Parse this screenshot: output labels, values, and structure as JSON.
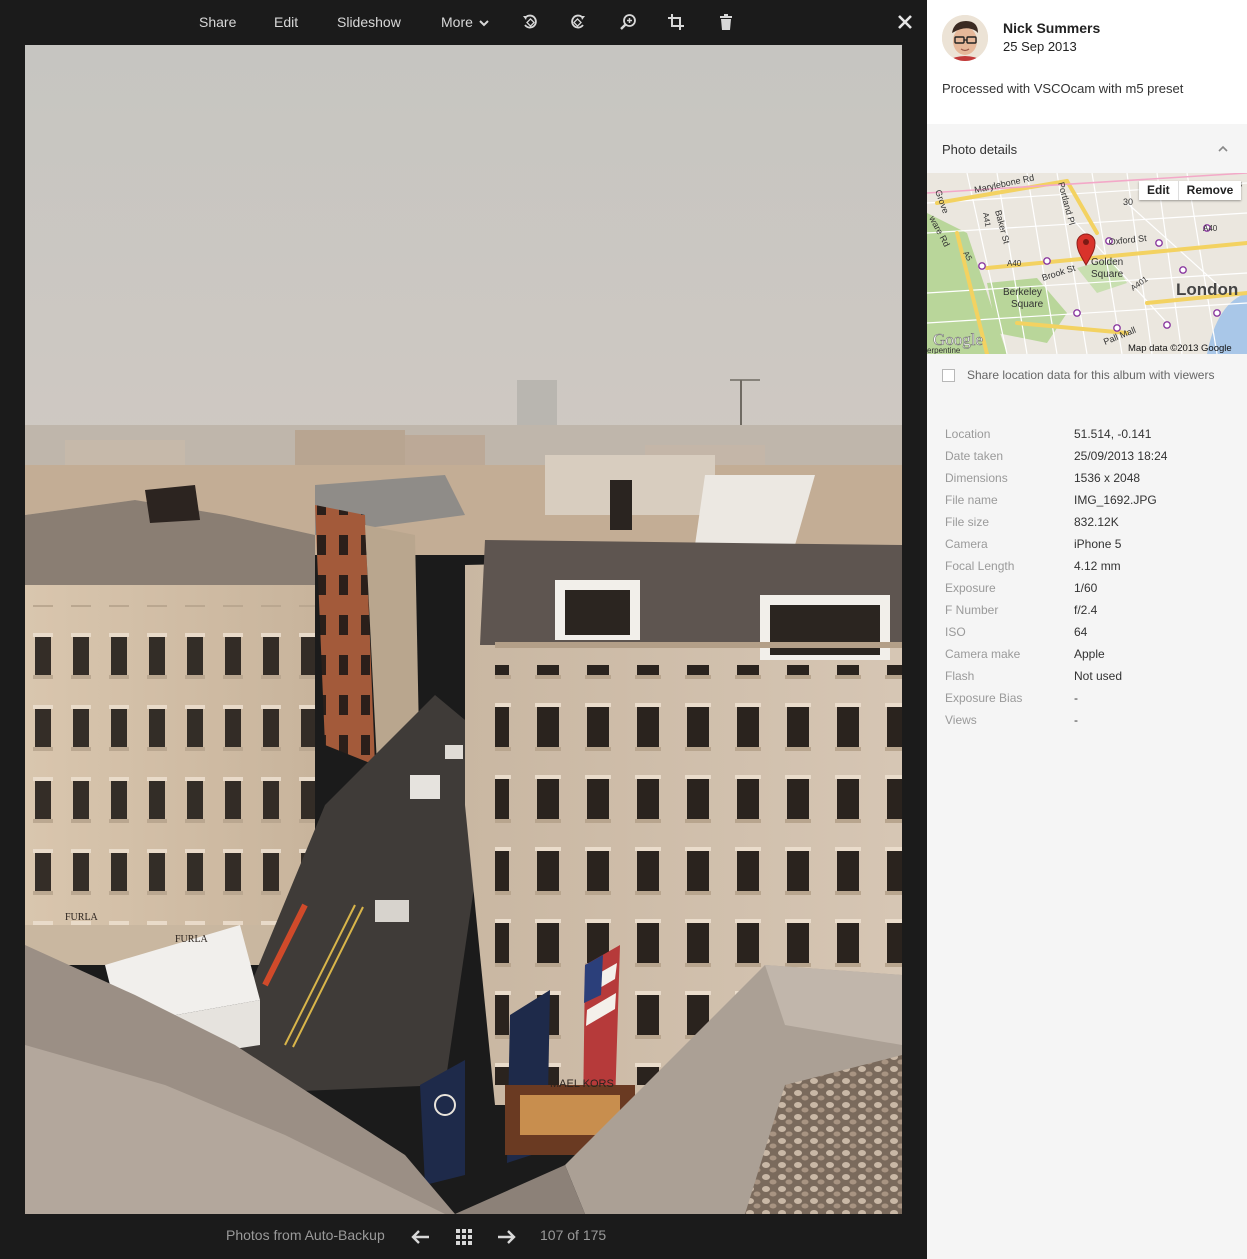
{
  "toolbar": {
    "share": "Share",
    "edit": "Edit",
    "slideshow": "Slideshow",
    "more": "More"
  },
  "bottom": {
    "album": "Photos from Auto-Backup",
    "counter": "107 of 175"
  },
  "panel": {
    "owner_name": "Nick Summers",
    "owner_date": "25 Sep 2013",
    "caption": "Processed with VSCOcam with m5 preset",
    "details_title": "Photo details",
    "map": {
      "edit": "Edit",
      "remove": "Remove",
      "labels": {
        "marylebone": "Marylebone Rd",
        "portland": "Portland Pl",
        "baker": "Baker St",
        "oxford": "Oxford St",
        "a40a": "A40",
        "a40b": "A40",
        "a41": "A41",
        "a5": "A5",
        "a401": "A401",
        "brook": "Brook St",
        "golden1": "Golden",
        "golden2": "Square",
        "berkeley1": "Berkeley",
        "berkeley2": "Square",
        "london": "London",
        "pallmall": "Pall Mall",
        "grove": "Grove",
        "ware": "ware Rd",
        "ys": "ys",
        "d30": "30",
        "serpentine": "erpentine",
        "google": "Google",
        "mapdata": "Map data ©2013 Google"
      }
    },
    "share_location": "Share location data for this album with viewers",
    "metadata": [
      {
        "k": "Location",
        "v": "51.514, -0.141"
      },
      {
        "k": "Date taken",
        "v": "25/09/2013 18:24"
      },
      {
        "k": "Dimensions",
        "v": "1536 x 2048"
      },
      {
        "k": "File name",
        "v": "IMG_1692.JPG"
      },
      {
        "k": "File size",
        "v": "832.12K"
      },
      {
        "k": "Camera",
        "v": "iPhone 5"
      },
      {
        "k": "Focal Length",
        "v": "4.12 mm"
      },
      {
        "k": "Exposure",
        "v": "1/60"
      },
      {
        "k": "F Number",
        "v": "f/2.4"
      },
      {
        "k": "ISO",
        "v": "64"
      },
      {
        "k": "Camera make",
        "v": "Apple"
      },
      {
        "k": "Flash",
        "v": "Not used"
      },
      {
        "k": "Exposure Bias",
        "v": "-"
      },
      {
        "k": "Views",
        "v": "-"
      }
    ]
  },
  "photo": {
    "furla1": "FURLA",
    "furla2": "FURLA",
    "kors": "MAEL KORS"
  },
  "colors": {
    "viewer_bg": "#1b1b1b",
    "panel_bg": "#f5f5f5",
    "sky": "#c9c8c4",
    "map_pin": "#d9332b"
  }
}
